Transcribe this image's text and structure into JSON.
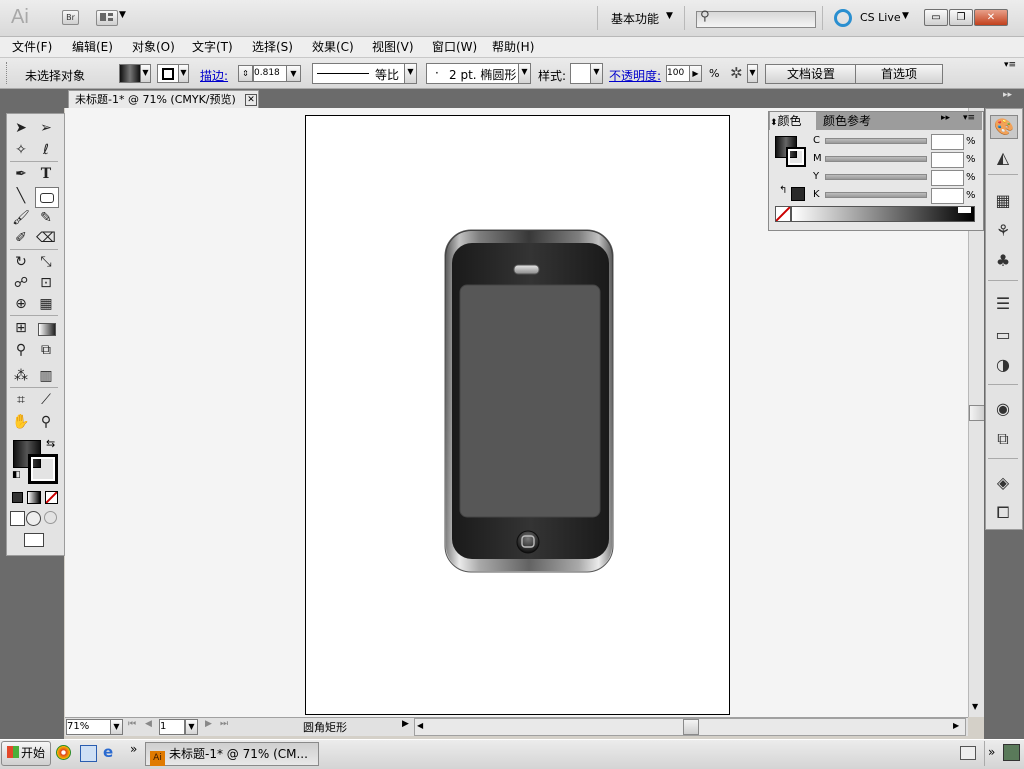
{
  "app": {
    "logo": "Ai",
    "bridge_label": "Br",
    "workspace": "基本功能",
    "cs_live": "CS Live",
    "window_buttons": {
      "minimize": "▭",
      "restore": "❐",
      "close": "✕"
    }
  },
  "menu": [
    "文件(F)",
    "编辑(E)",
    "对象(O)",
    "文字(T)",
    "选择(S)",
    "效果(C)",
    "视图(V)",
    "窗口(W)",
    "帮助(H)"
  ],
  "control": {
    "selection_status": "未选择对象",
    "stroke_label": "描边:",
    "stroke_value": "0.818 p",
    "profile_label": "等比",
    "brush_label": "2 pt. 椭圆形",
    "style_label": "样式:",
    "opacity_label": "不透明度:",
    "opacity_value": "100",
    "percent": "%",
    "doc_setup_button": "文档设置",
    "preferences_button": "首选项"
  },
  "document": {
    "tab_title": "未标题-1* @ 71% (CMYK/预览)",
    "zoom": "71%",
    "page": "1",
    "status": "圆角矩形"
  },
  "color_panel": {
    "tab_color": "颜色",
    "tab_guide": "颜色参考",
    "channels": [
      "C",
      "M",
      "Y",
      "K"
    ],
    "percent": "%"
  },
  "taskbar": {
    "start": "开始",
    "task_item": "未标题-1* @ 71% (CM...",
    "overflow": "»"
  },
  "colors": {
    "phone_body": "#2e2e2e",
    "phone_screen": "#575757",
    "bezel_light": "#e8e8e8",
    "canvas_bg": "#f4f4f4",
    "panel_bg": "#6b6b6b"
  }
}
